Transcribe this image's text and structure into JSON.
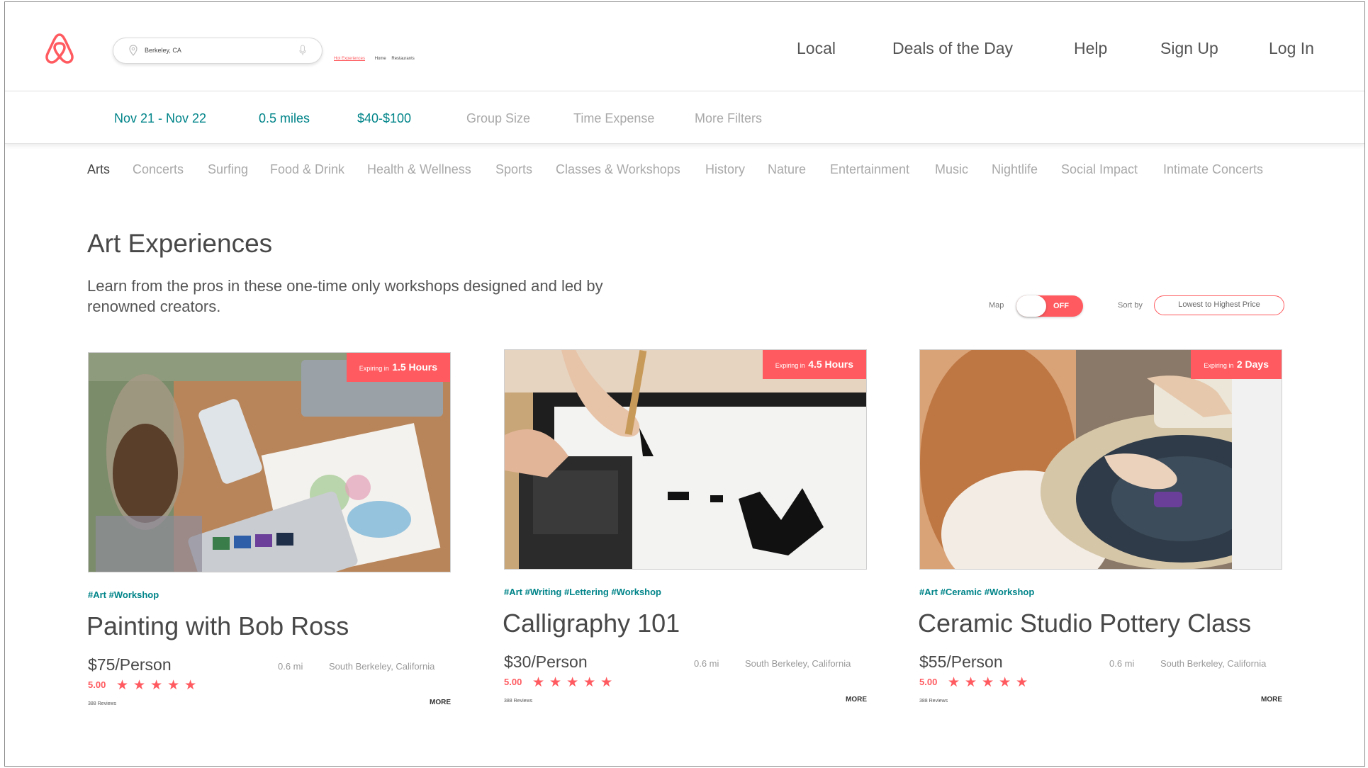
{
  "header": {
    "search": {
      "value": "Berkeley, CA"
    },
    "mini_links": {
      "hot": "Hot Experiences",
      "home": "Home",
      "restaurants": "Restaurants"
    },
    "nav": [
      "Local",
      "Deals of the Day",
      "Help",
      "Sign Up",
      "Log In"
    ]
  },
  "filters": {
    "dates": "Nov 21 - Nov 22",
    "distance": "0.5 miles",
    "price": "$40-$100",
    "group_size": "Group Size",
    "time_expense": "Time Expense",
    "more_filters": "More Filters"
  },
  "categories": [
    "Arts",
    "Concerts",
    "Surfing",
    "Food & Drink",
    "Health & Wellness",
    "Sports",
    "Classes & Workshops",
    "History",
    "Nature",
    "Entertainment",
    "Music",
    "Nightlife",
    "Social Impact",
    "Intimate Concerts"
  ],
  "section": {
    "title": "Art Experiences",
    "description": "Learn from the pros in these one-time only workshops designed and led by renowned creators.",
    "map_label": "Map",
    "map_toggle": "OFF",
    "sort_label": "Sort by",
    "sort_value": "Lowest to Highest Price"
  },
  "cards": [
    {
      "expire_prefix": "Expiring in",
      "expire_value": "1.5 Hours",
      "tags": "#Art #Workshop",
      "title": "Painting with Bob Ross",
      "price": "$75/Person",
      "distance": "0.6 mi",
      "location": "South Berkeley, California",
      "rating": "5.00",
      "stars": "★★★★★",
      "reviews": "388 Reviews",
      "more": "MORE"
    },
    {
      "expire_prefix": "Expiring in",
      "expire_value": "4.5 Hours",
      "tags": "#Art #Writing #Lettering #Workshop",
      "title": "Calligraphy 101",
      "price": "$30/Person",
      "distance": "0.6 mi",
      "location": "South Berkeley, California",
      "rating": "5.00",
      "stars": "★★★★★",
      "reviews": "388 Reviews",
      "more": "MORE"
    },
    {
      "expire_prefix": "Expiring in",
      "expire_value": "2 Days",
      "tags": "#Art #Ceramic #Workshop",
      "title": "Ceramic Studio Pottery Class",
      "price": "$55/Person",
      "distance": "0.6 mi",
      "location": "South Berkeley, California",
      "rating": "5.00",
      "stars": "★★★★★",
      "reviews": "388 Reviews",
      "more": "MORE"
    }
  ],
  "colors": {
    "accent": "#ff5a5f",
    "teal": "#008489",
    "text": "#484848",
    "muted": "#a9a9a9"
  }
}
